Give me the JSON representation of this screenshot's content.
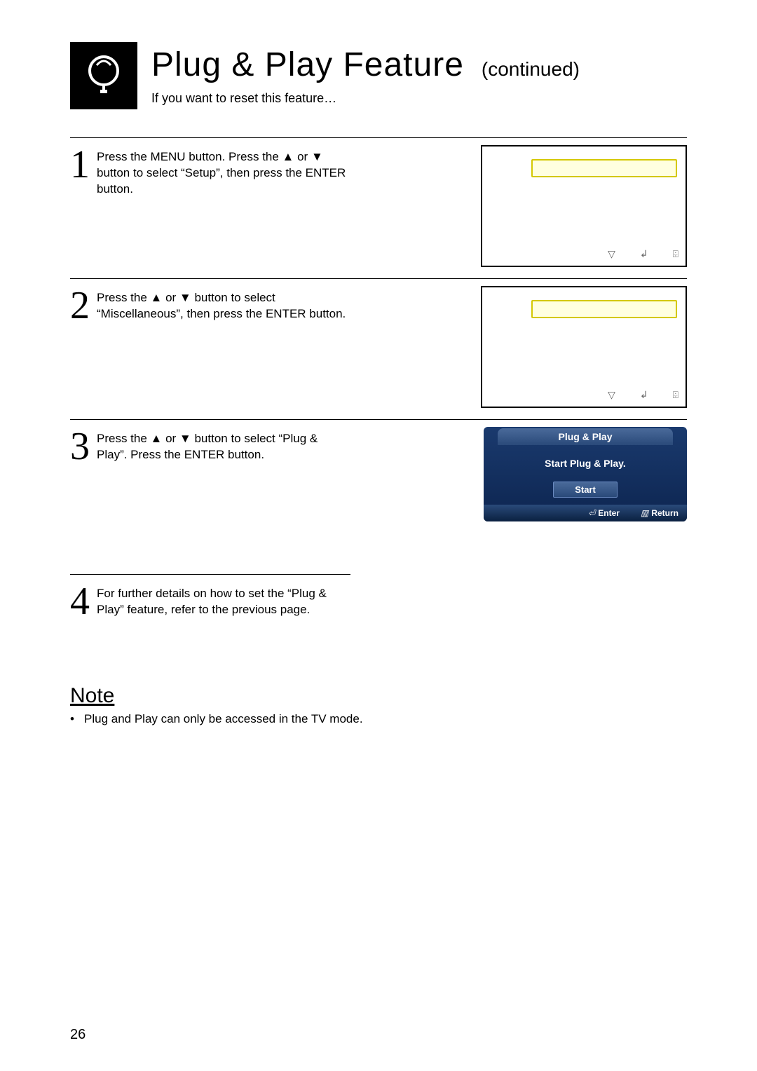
{
  "header": {
    "title": "Plug & Play Feature",
    "continued": "(continued)",
    "subtitle": "If you want to reset this feature…"
  },
  "steps": {
    "s1": {
      "num": "1",
      "text": "Press the MENU button. Press the ▲ or ▼ button to select “Setup”, then press the ENTER button."
    },
    "s2": {
      "num": "2",
      "text": "Press the ▲ or ▼ button to select “Miscellaneous”, then press the ENTER button."
    },
    "s3": {
      "num": "3",
      "text": "Press the ▲ or ▼ button to select “Plug & Play”. Press the ENTER button."
    },
    "s4": {
      "num": "4",
      "text": "For further details on how to set the “Plug & Play” feature, refer to the previous page."
    }
  },
  "tv_icons": {
    "down": "▽",
    "enter": "↲",
    "return": "⌹"
  },
  "plugplay": {
    "title": "Plug & Play",
    "message": "Start Plug & Play.",
    "start": "Start",
    "enter": "Enter",
    "return": "Return"
  },
  "note": {
    "heading": "Note",
    "bullet": "•",
    "text": "Plug and Play can only be accessed in the TV mode."
  },
  "page": "26"
}
